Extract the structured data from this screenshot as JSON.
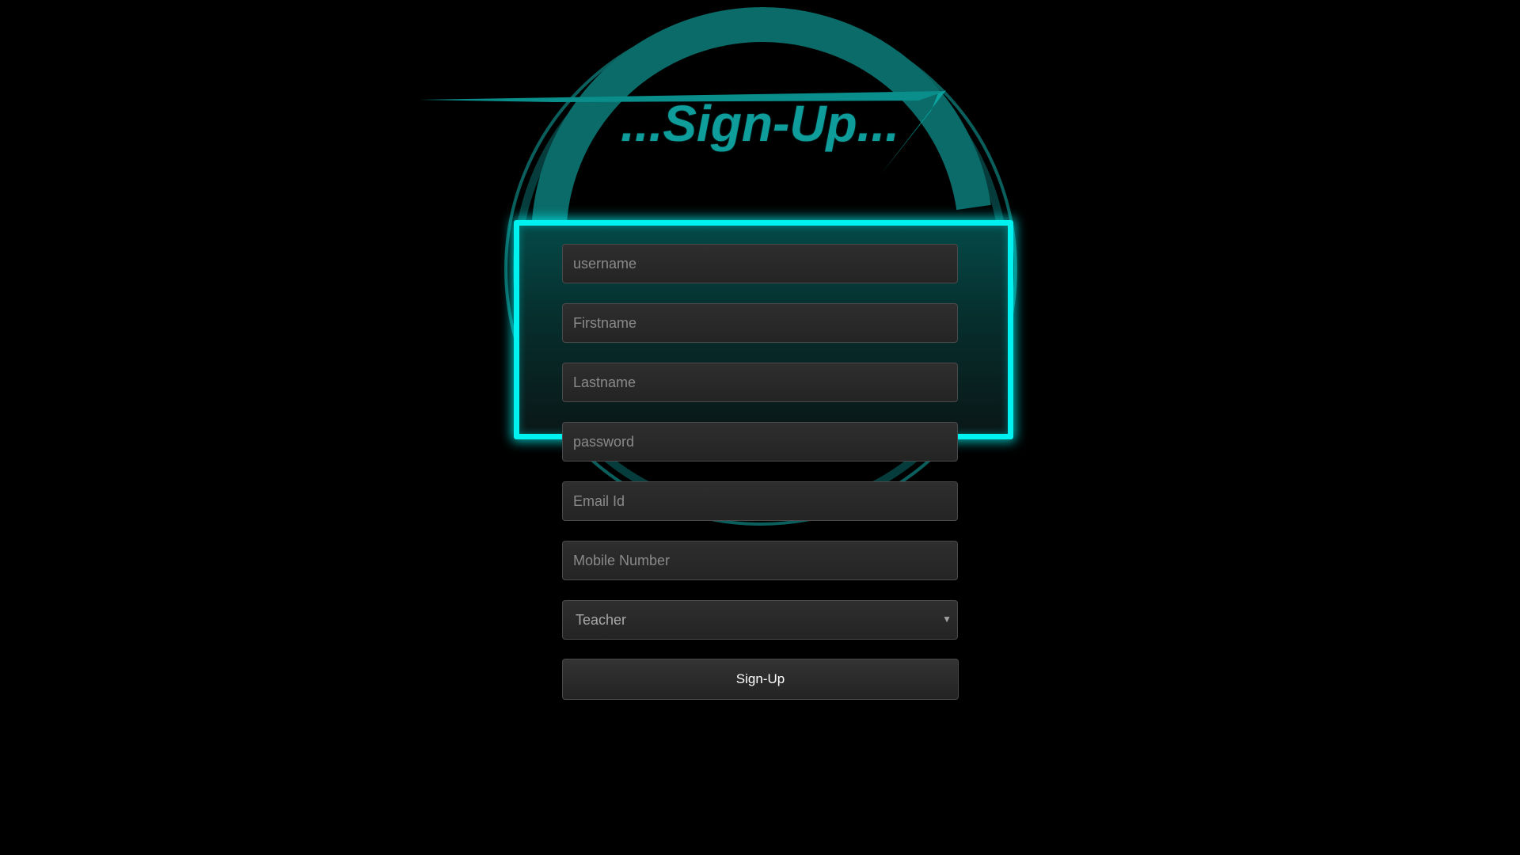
{
  "page": {
    "title": "...Sign-Up..."
  },
  "form": {
    "username_placeholder": "username",
    "firstname_placeholder": "Firstname",
    "lastname_placeholder": "Lastname",
    "password_placeholder": "password",
    "email_placeholder": "Email Id",
    "mobile_placeholder": "Mobile Number",
    "role": {
      "selected": "Teacher"
    },
    "submit_label": "Sign-Up"
  },
  "theme": {
    "background": "#000000",
    "accent_glow": "#00f2f0",
    "ring_color": "#0a6b69",
    "title_color": "#0e9d9a"
  }
}
